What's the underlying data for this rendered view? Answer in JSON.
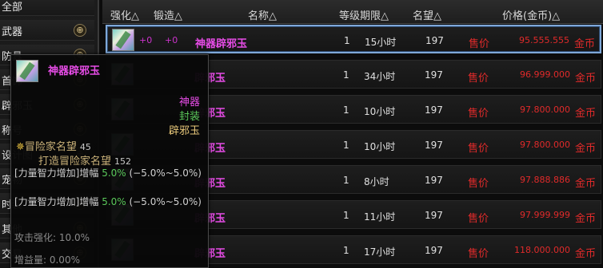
{
  "sidebar": {
    "items": [
      {
        "label": "全部",
        "zoom": false
      },
      {
        "label": "武器",
        "zoom": true
      },
      {
        "label": "防具",
        "zoom": true
      },
      {
        "label": "首饰",
        "zoom": true
      },
      {
        "label": "辟邪玉",
        "zoom": true
      },
      {
        "label": "称号",
        "zoom": true
      },
      {
        "label": "设计图",
        "zoom": true
      },
      {
        "label": "宠物",
        "zoom": true
      },
      {
        "label": "时装",
        "zoom": true
      },
      {
        "label": "其他",
        "zoom": true
      },
      {
        "label": "交易",
        "zoom": true
      }
    ],
    "zoom_glyph": "⊕"
  },
  "header": {
    "strengthen": "强化△",
    "forge": "锻造△",
    "name": "名称△",
    "level_duration": "等级期限△",
    "reputation": "名望△",
    "price": "价格(金币)△"
  },
  "listings": [
    {
      "strengthen": "+0",
      "forge": "+0",
      "name": "神器辟邪玉",
      "level": "1",
      "duration": "15小时",
      "reputation": "197",
      "sell_label": "售价",
      "price": "95.555.555",
      "unit": "金币",
      "selected": true
    },
    {
      "strengthen": "",
      "forge": "",
      "name": "辟邪玉",
      "level": "1",
      "duration": "34小时",
      "reputation": "197",
      "sell_label": "售价",
      "price": "96.999.000",
      "unit": "金币",
      "selected": false
    },
    {
      "strengthen": "",
      "forge": "",
      "name": "辟邪玉",
      "level": "1",
      "duration": "10小时",
      "reputation": "197",
      "sell_label": "售价",
      "price": "97.800.000",
      "unit": "金币",
      "selected": false
    },
    {
      "strengthen": "",
      "forge": "",
      "name": "辟邪玉",
      "level": "1",
      "duration": "10小时",
      "reputation": "197",
      "sell_label": "售价",
      "price": "97.800.000",
      "unit": "金币",
      "selected": false
    },
    {
      "strengthen": "",
      "forge": "",
      "name": "辟邪玉",
      "level": "1",
      "duration": "8小时",
      "reputation": "197",
      "sell_label": "售价",
      "price": "97.888.886",
      "unit": "金币",
      "selected": false
    },
    {
      "strengthen": "",
      "forge": "",
      "name": "辟邪玉",
      "level": "1",
      "duration": "11小时",
      "reputation": "197",
      "sell_label": "售价",
      "price": "97.999.999",
      "unit": "金币",
      "selected": false
    },
    {
      "strengthen": "",
      "forge": "",
      "name": "辟邪玉",
      "level": "1",
      "duration": "17小时",
      "reputation": "197",
      "sell_label": "售价",
      "price": "118.000.000",
      "unit": "金币",
      "selected": false
    }
  ],
  "tooltip": {
    "name": "神器辟邪玉",
    "rarity": "神器",
    "state": "封装",
    "type": "辟邪玉",
    "adventurer_rep_label": "冒险家名望",
    "adventurer_rep_value": "45",
    "forge_rep_label": "打造冒险家名望",
    "forge_rep_value": "152",
    "stat1_prefix": "[力量智力增加]增幅 ",
    "stat1_pct": "5.0%",
    "stat1_suffix": " (−5.0%~5.0%)",
    "stat2_prefix": "[力量智力增加]增幅 ",
    "stat2_pct": "5.0%",
    "stat2_suffix": " (−5.0%~5.0%)",
    "attack_strengthen": "攻击强化: 10.0%",
    "gain": "增益量: 0.00%"
  }
}
